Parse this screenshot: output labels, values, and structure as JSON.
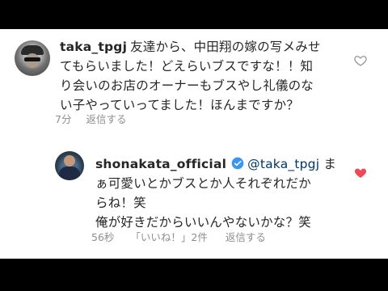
{
  "comments": [
    {
      "username": "taka_tpgj",
      "text_lines": [
        "友達から、中田翔の嫁の写メみせ",
        "てもらいました！どえらいブスですな！！知",
        "り会いのお店のオーナーもブスやし礼儀のな",
        "い子やっていってました！ほんまですか？"
      ],
      "time": "7分",
      "reply_label": "返信する",
      "liked": false
    },
    {
      "username": "shonakata_official",
      "verified": true,
      "mention": "@taka_tpgj",
      "text_lines": [
        " ま",
        "ぁ可愛いとかブスとか人それぞれだか",
        "らね！笑",
        "俺が好きだからいいんやないかな？笑"
      ],
      "time": "56秒",
      "likes_label": "「いいね！」2件",
      "reply_label": "返信する",
      "liked": true
    }
  ],
  "colors": {
    "text": "#262626",
    "meta": "#8e8e8e",
    "mention": "#00376b",
    "heart_liked": "#ed4956",
    "verified": "#3897f0",
    "letterbox": "#000000"
  },
  "icons": {
    "like_empty": "heart-outline-icon",
    "like_filled": "heart-filled-icon",
    "verified": "verified-badge-icon"
  }
}
